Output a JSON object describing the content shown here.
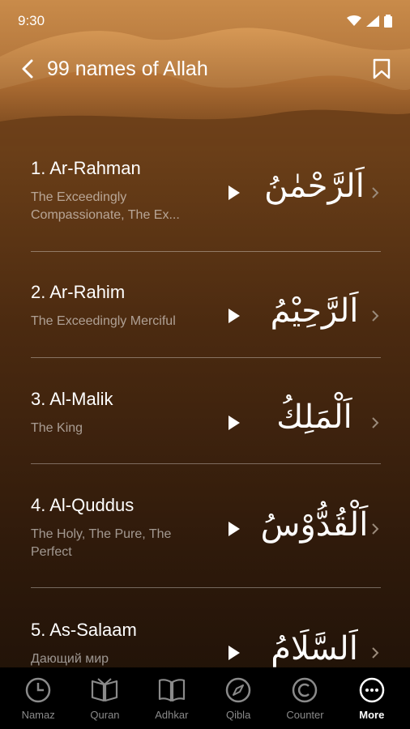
{
  "status_bar": {
    "time": "9:30"
  },
  "header": {
    "title": "99 names of Allah"
  },
  "names": [
    {
      "title": "1. Ar-Rahman",
      "meaning": "The Exceedingly Compassionate, The Ex...",
      "arabic": "اَلرَّحْمٰنُ"
    },
    {
      "title": "2. Ar-Rahim",
      "meaning": "The Exceedingly Merciful",
      "arabic": "اَلرَّحِيْمُ"
    },
    {
      "title": "3. Al-Malik",
      "meaning": "The King",
      "arabic": "اَلْمَلِكُ"
    },
    {
      "title": "4. Al-Quddus",
      "meaning": "The Holy, The Pure, The Perfect",
      "arabic": "اَلْقُدُّوْسُ"
    },
    {
      "title": "5. As-Salaam",
      "meaning": "Дающий мир",
      "arabic": "اَلسَّلَامُ"
    }
  ],
  "tabbar": {
    "tabs": [
      {
        "label": "Namaz",
        "icon": "clock-icon"
      },
      {
        "label": "Quran",
        "icon": "open-book-icon"
      },
      {
        "label": "Adhkar",
        "icon": "book-icon"
      },
      {
        "label": "Qibla",
        "icon": "compass-icon"
      },
      {
        "label": "Counter",
        "icon": "counter-icon"
      },
      {
        "label": "More",
        "icon": "more-icon"
      }
    ],
    "active": "More"
  },
  "colors": {
    "background_top": "#8a5526",
    "background_bottom": "#1c1007",
    "tabbar": "#000000",
    "active_tab": "#ffffff",
    "inactive_tab": "#8a8a8a"
  }
}
